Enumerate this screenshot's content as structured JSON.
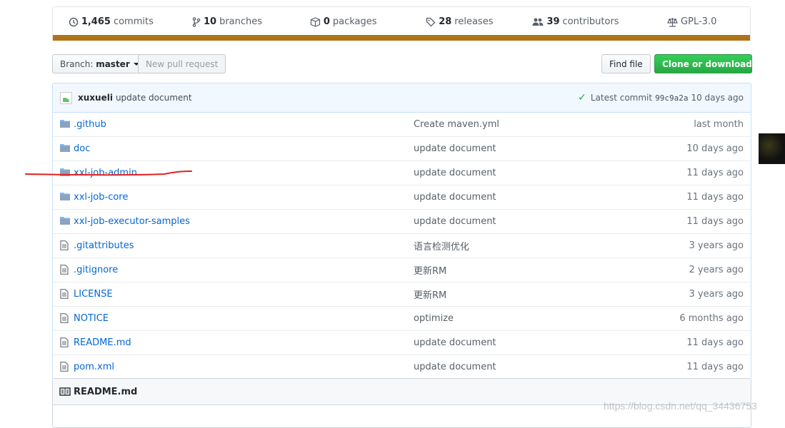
{
  "summary": {
    "commits": {
      "count": "1,465",
      "label": "commits"
    },
    "branches": {
      "count": "10",
      "label": "branches"
    },
    "packages": {
      "count": "0",
      "label": "packages"
    },
    "releases": {
      "count": "28",
      "label": "releases"
    },
    "contributors": {
      "count": "39",
      "label": "contributors"
    },
    "license": "GPL-3.0",
    "language_bar_color": "#b07219"
  },
  "toolbar": {
    "branch_label": "Branch:",
    "branch_value": "master",
    "new_pull_request": "New pull request",
    "find_file": "Find file",
    "clone_download": "Clone or download"
  },
  "commit": {
    "author": "xuxueli",
    "message": "update document",
    "latest_label": "Latest commit",
    "sha": "99c9a2a",
    "age": "10 days ago"
  },
  "files": [
    {
      "type": "dir",
      "name": ".github",
      "message": "Create maven.yml",
      "age": "last month"
    },
    {
      "type": "dir",
      "name": "doc",
      "message": "update document",
      "age": "10 days ago"
    },
    {
      "type": "dir",
      "name": "xxl-job-admin",
      "message": "update document",
      "age": "11 days ago"
    },
    {
      "type": "dir",
      "name": "xxl-job-core",
      "message": "update document",
      "age": "11 days ago"
    },
    {
      "type": "dir",
      "name": "xxl-job-executor-samples",
      "message": "update document",
      "age": "11 days ago"
    },
    {
      "type": "file",
      "name": ".gitattributes",
      "message": "语言检测优化",
      "age": "3 years ago"
    },
    {
      "type": "file",
      "name": ".gitignore",
      "message": "更新RM",
      "age": "2 years ago"
    },
    {
      "type": "file",
      "name": "LICENSE",
      "message": "更新RM",
      "age": "3 years ago"
    },
    {
      "type": "file",
      "name": "NOTICE",
      "message": "optimize",
      "age": "6 months ago"
    },
    {
      "type": "file",
      "name": "README.md",
      "message": "update document",
      "age": "11 days ago"
    },
    {
      "type": "file",
      "name": "pom.xml",
      "message": "update document",
      "age": "11 days ago"
    }
  ],
  "readme": {
    "title": "README.md"
  },
  "watermark": "https://blog.csdn.net/qq_34436753",
  "colors": {
    "link": "#0366d6",
    "green": "#28a745",
    "annotation": "#e02020"
  }
}
